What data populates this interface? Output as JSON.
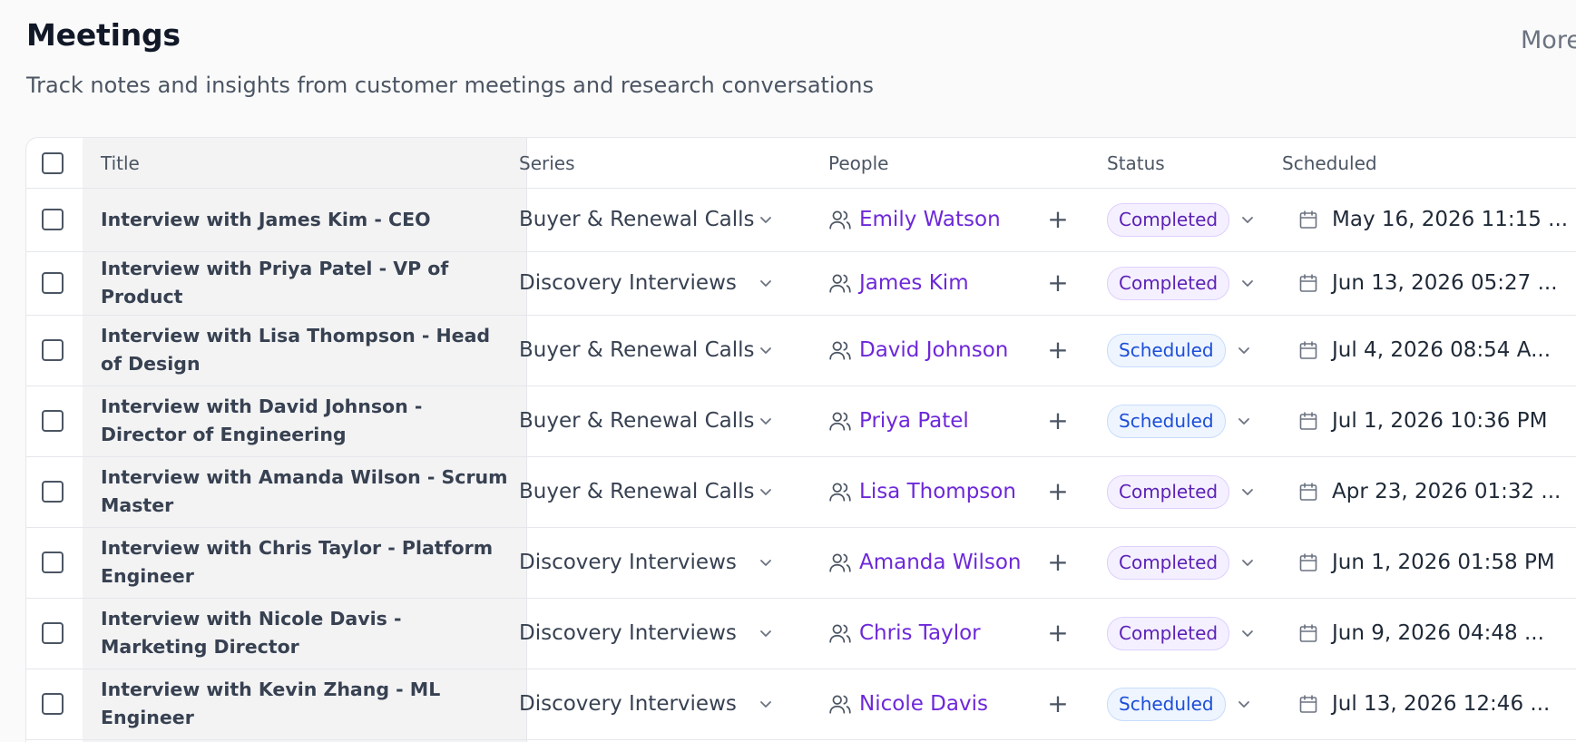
{
  "page": {
    "title": "Meetings",
    "subtitle": "Track notes and insights from customer meetings and research conversations",
    "more_label": "More"
  },
  "table": {
    "headers": {
      "title": "Title",
      "series": "Series",
      "people": "People",
      "status": "Status",
      "scheduled": "Scheduled"
    },
    "rows": [
      {
        "title": "Interview with James Kim - CEO",
        "series": "Buyer & Renewal Calls",
        "person": "Emily Watson",
        "status": "Completed",
        "scheduled": "May 16, 2026 11:15 ..."
      },
      {
        "title": "Interview with Priya Patel - VP of Product",
        "series": "Discovery Interviews",
        "person": "James Kim",
        "status": "Completed",
        "scheduled": "Jun 13, 2026 05:27 ..."
      },
      {
        "title": "Interview with Lisa Thompson - Head of Design",
        "series": "Buyer & Renewal Calls",
        "person": "David Johnson",
        "status": "Scheduled",
        "scheduled": "Jul 4, 2026 08:54 A..."
      },
      {
        "title": "Interview with David Johnson - Director of Engineering",
        "series": "Buyer & Renewal Calls",
        "person": "Priya Patel",
        "status": "Scheduled",
        "scheduled": "Jul 1, 2026 10:36 PM"
      },
      {
        "title": "Interview with Amanda Wilson - Scrum Master",
        "series": "Buyer & Renewal Calls",
        "person": "Lisa Thompson",
        "status": "Completed",
        "scheduled": "Apr 23, 2026 01:32 ..."
      },
      {
        "title": "Interview with Chris Taylor - Platform Engineer",
        "series": "Discovery Interviews",
        "person": "Amanda Wilson",
        "status": "Completed",
        "scheduled": "Jun 1, 2026 01:58 PM"
      },
      {
        "title": "Interview with Nicole Davis - Marketing Director",
        "series": "Discovery Interviews",
        "person": "Chris Taylor",
        "status": "Completed",
        "scheduled": "Jun 9, 2026 04:48 ..."
      },
      {
        "title": "Interview with Kevin Zhang - ML Engineer",
        "series": "Discovery Interviews",
        "person": "Nicole Davis",
        "status": "Scheduled",
        "scheduled": "Jul 13, 2026 12:46 ..."
      }
    ]
  },
  "icons": {
    "select_all": "checkbox-icon",
    "series_dropdown": "chevron-down-icon",
    "person": "users-icon",
    "add_person": "plus-icon",
    "status_dropdown": "chevron-down-icon",
    "date": "calendar-icon"
  },
  "colors": {
    "link_purple": "#6d28d9",
    "completed_badge_bg": "#f5f0ff",
    "completed_badge_text": "#5b21b6",
    "scheduled_badge_bg": "#eef5ff",
    "scheduled_badge_text": "#1d4ed8"
  }
}
